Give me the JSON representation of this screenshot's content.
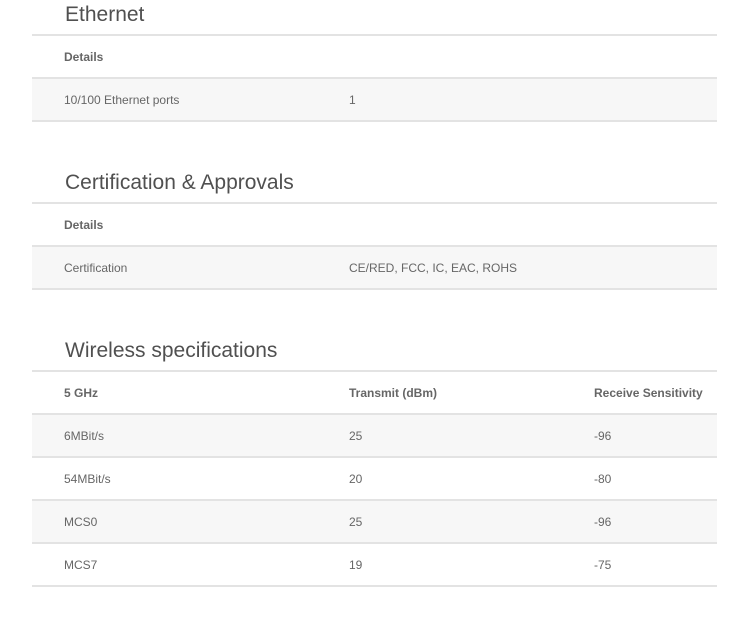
{
  "sections": {
    "ethernet": {
      "title": "Ethernet",
      "header": "Details",
      "rows": [
        {
          "label": "10/100 Ethernet ports",
          "value": "1"
        }
      ]
    },
    "certification": {
      "title": "Certification & Approvals",
      "header": "Details",
      "rows": [
        {
          "label": "Certification",
          "value": "CE/RED, FCC, IC, EAC, ROHS"
        }
      ]
    },
    "wireless": {
      "title": "Wireless specifications",
      "columns": [
        "5 GHz",
        "Transmit (dBm)",
        "Receive Sensitivity"
      ],
      "rows": [
        {
          "rate": "6MBit/s",
          "transmit": "25",
          "receive": "-96"
        },
        {
          "rate": "54MBit/s",
          "transmit": "20",
          "receive": "-80"
        },
        {
          "rate": "MCS0",
          "transmit": "25",
          "receive": "-96"
        },
        {
          "rate": "MCS7",
          "transmit": "19",
          "receive": "-75"
        }
      ]
    }
  }
}
